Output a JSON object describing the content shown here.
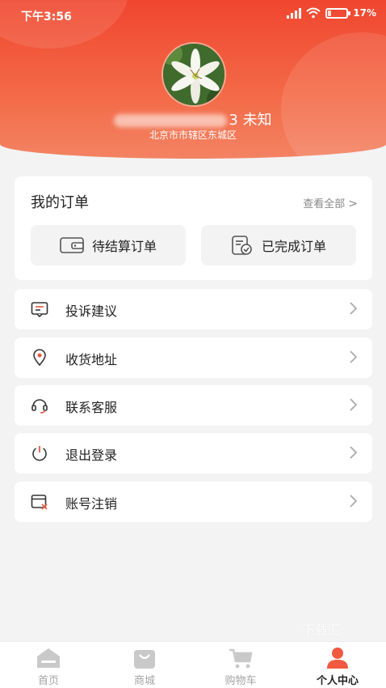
{
  "status_bar": {
    "time": "下午3:56",
    "battery_percent": "17%",
    "battery_level": 0.17
  },
  "profile": {
    "name_suffix": "3 未知",
    "address": "北京市市辖区东城区"
  },
  "orders": {
    "title": "我的订单",
    "view_all": "查看全部",
    "buttons": [
      {
        "label": "待结算订单",
        "icon": "wallet-icon"
      },
      {
        "label": "已完成订单",
        "icon": "completed-order-icon"
      }
    ]
  },
  "menu": [
    {
      "label": "投诉建议",
      "icon": "message-icon"
    },
    {
      "label": "收货地址",
      "icon": "location-pin-icon"
    },
    {
      "label": "联系客服",
      "icon": "headset-icon"
    },
    {
      "label": "退出登录",
      "icon": "power-icon"
    },
    {
      "label": "账号注销",
      "icon": "account-cancel-icon"
    }
  ],
  "watermark": "下载汇",
  "tabbar": [
    {
      "label": "首页",
      "icon": "home-icon",
      "active": false
    },
    {
      "label": "商城",
      "icon": "shopping-bag-icon",
      "active": false
    },
    {
      "label": "购物车",
      "icon": "cart-icon",
      "active": false
    },
    {
      "label": "个人中心",
      "icon": "user-icon",
      "active": true
    }
  ],
  "colors": {
    "header_top": "#f0462f",
    "header_bottom": "#f38363",
    "accent": "#f05a40",
    "inactive_tab": "#a4a4a4"
  }
}
